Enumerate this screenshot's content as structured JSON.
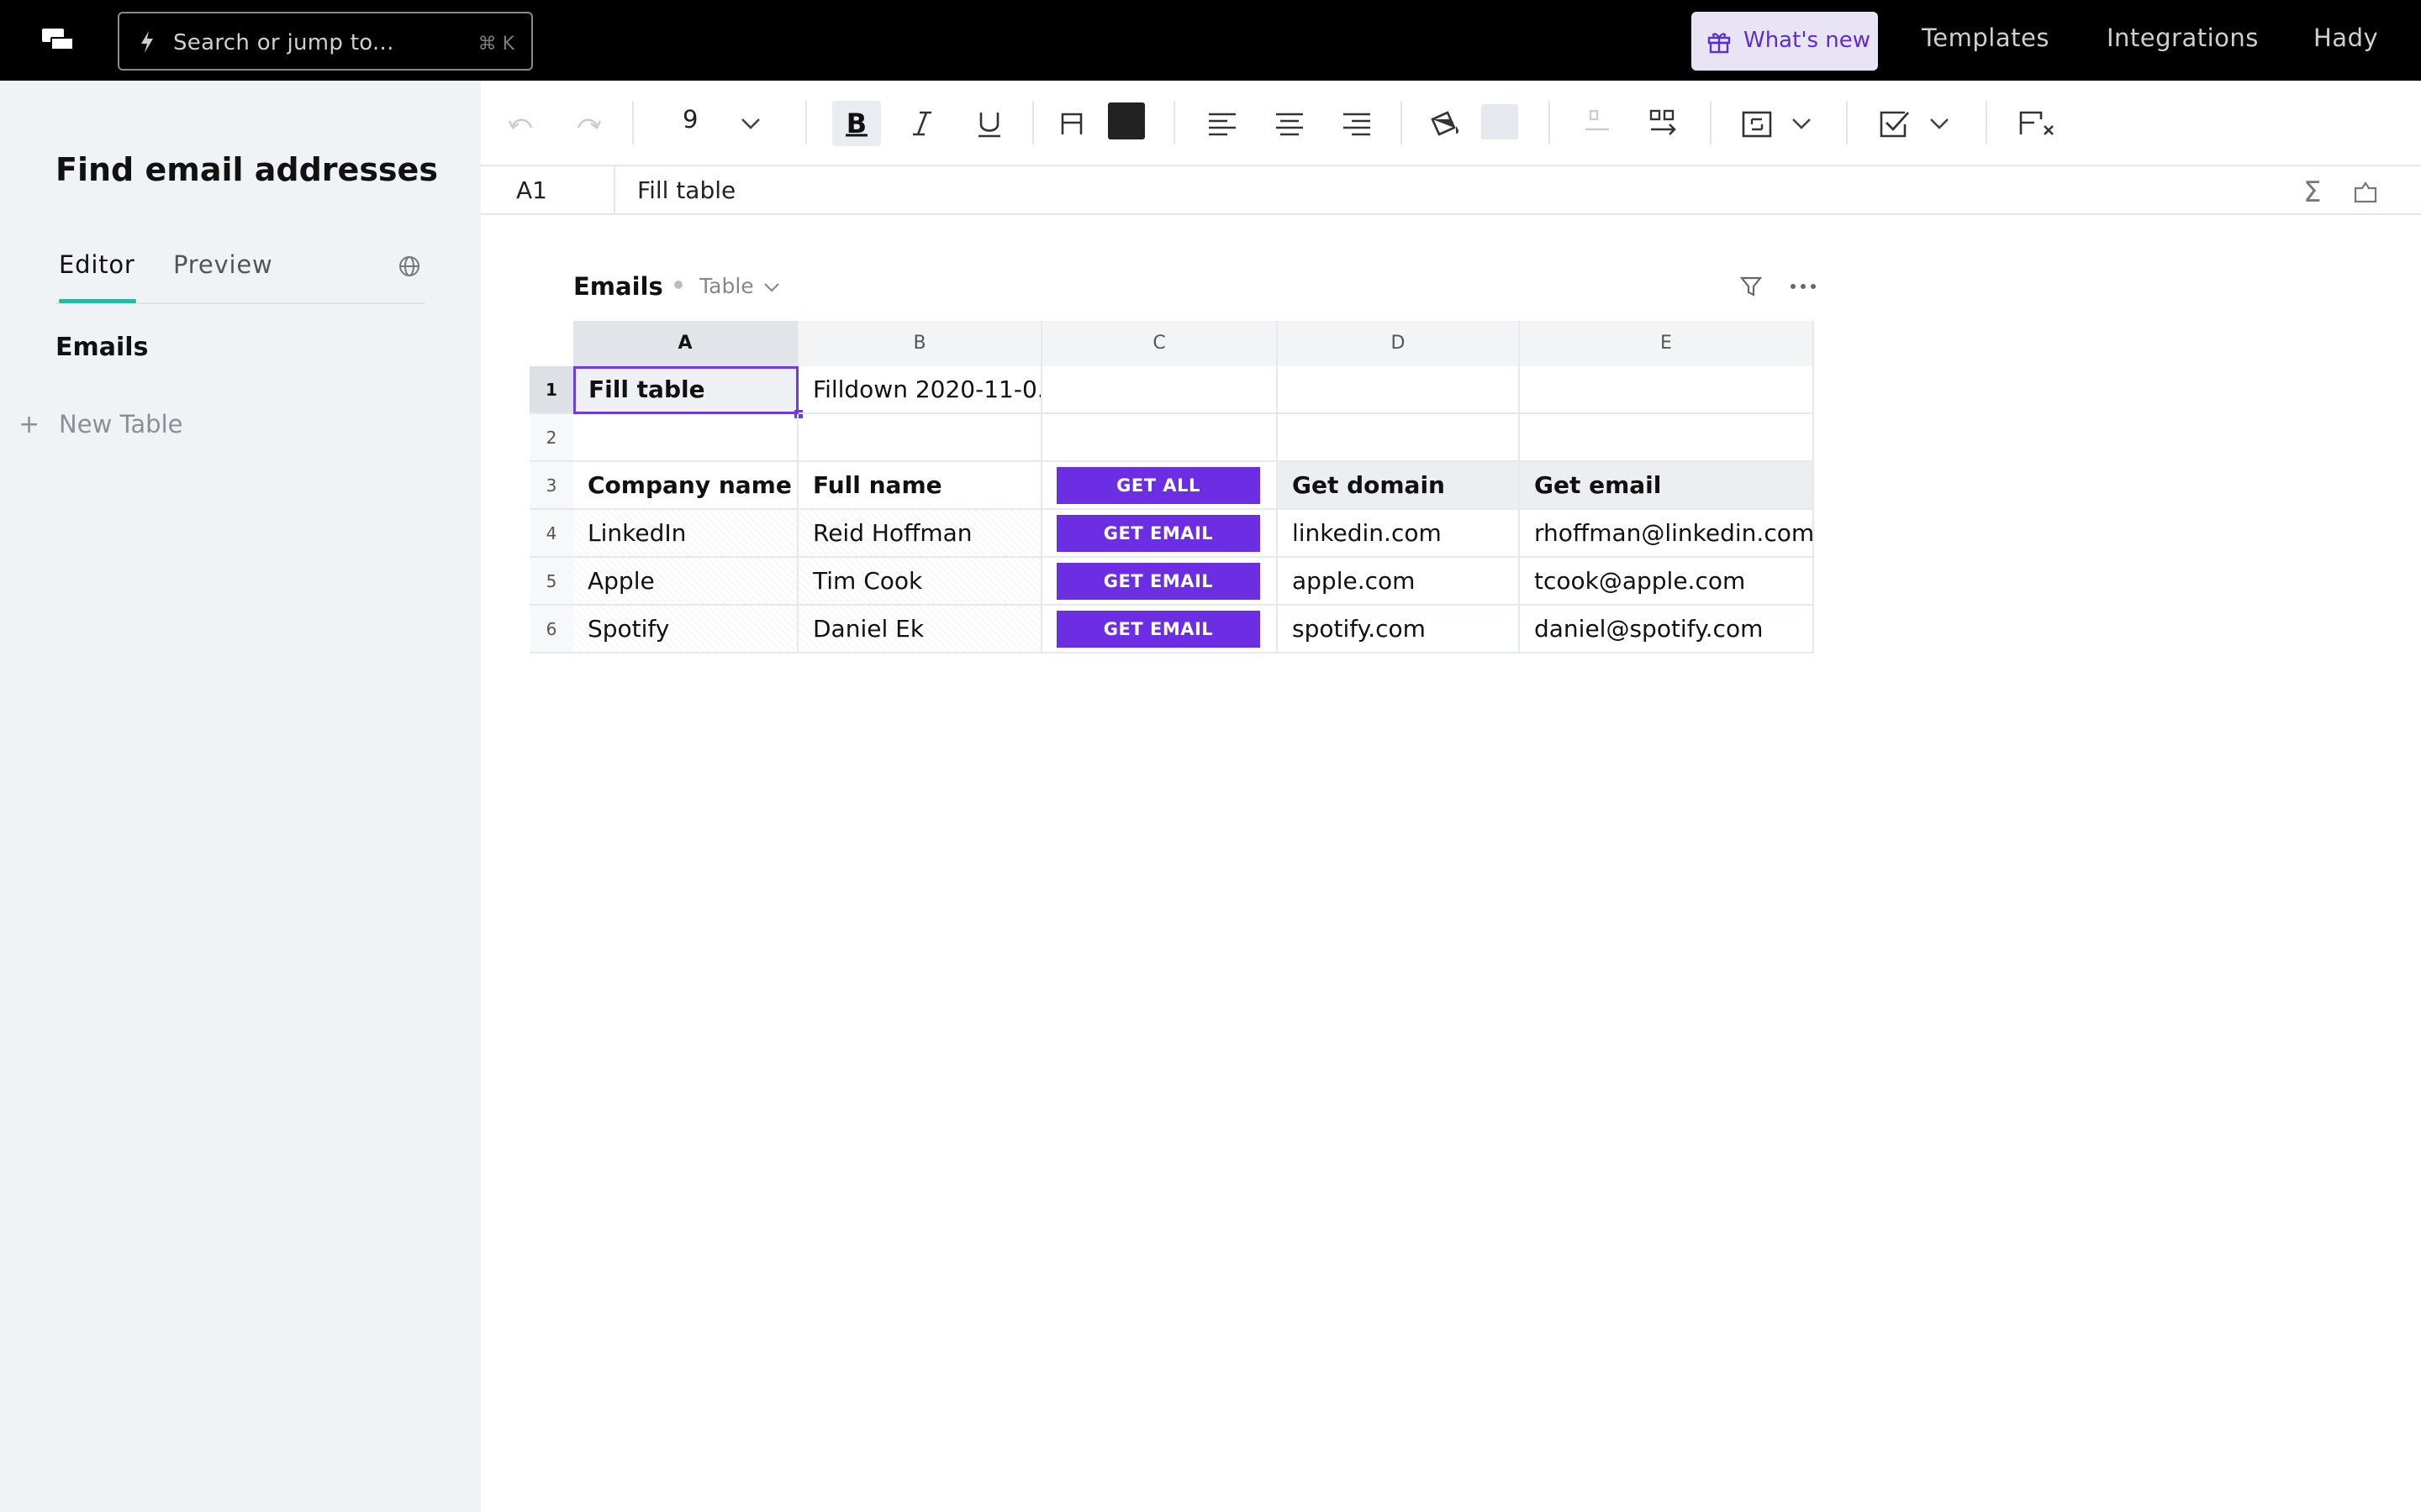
{
  "topbar": {
    "search_placeholder": "Search or jump to...",
    "search_shortcut": "⌘ K",
    "whats_new": "What's new",
    "nav": [
      "Templates",
      "Integrations",
      "Hady"
    ]
  },
  "sidebar": {
    "doc_title": "Find email addresses",
    "tabs": [
      "Editor",
      "Preview"
    ],
    "active_tab": "Editor",
    "tables": [
      "Emails"
    ],
    "new_table": "New Table"
  },
  "toolbar": {
    "font_size": "9",
    "text_color": "#222222",
    "fill_color": "#e5e8ec"
  },
  "formula_bar": {
    "cell_ref": "A1",
    "value": "Fill table"
  },
  "table": {
    "title": "Emails",
    "type": "Table",
    "columns": [
      "A",
      "B",
      "C",
      "D",
      "E"
    ],
    "rows": [
      "1",
      "2",
      "3",
      "4",
      "5",
      "6"
    ],
    "cells": {
      "r1": [
        "Fill table",
        "Filldown 2020-11-0...",
        "",
        "",
        ""
      ],
      "r2": [
        "",
        "",
        "",
        "",
        ""
      ],
      "r3": [
        "Company name",
        "Full name",
        "GET ALL",
        "Get domain",
        "Get email"
      ],
      "r4": [
        "LinkedIn",
        "Reid Hoffman",
        "GET EMAIL",
        "linkedin.com",
        "rhoffman@linkedin.com"
      ],
      "r5": [
        "Apple",
        "Tim Cook",
        "GET EMAIL",
        "apple.com",
        "tcook@apple.com"
      ],
      "r6": [
        "Spotify",
        "Daniel Ek",
        "GET EMAIL",
        "spotify.com",
        "daniel@spotify.com"
      ]
    },
    "accent_color": "#6b2ee2",
    "selected_cell": "A1"
  }
}
